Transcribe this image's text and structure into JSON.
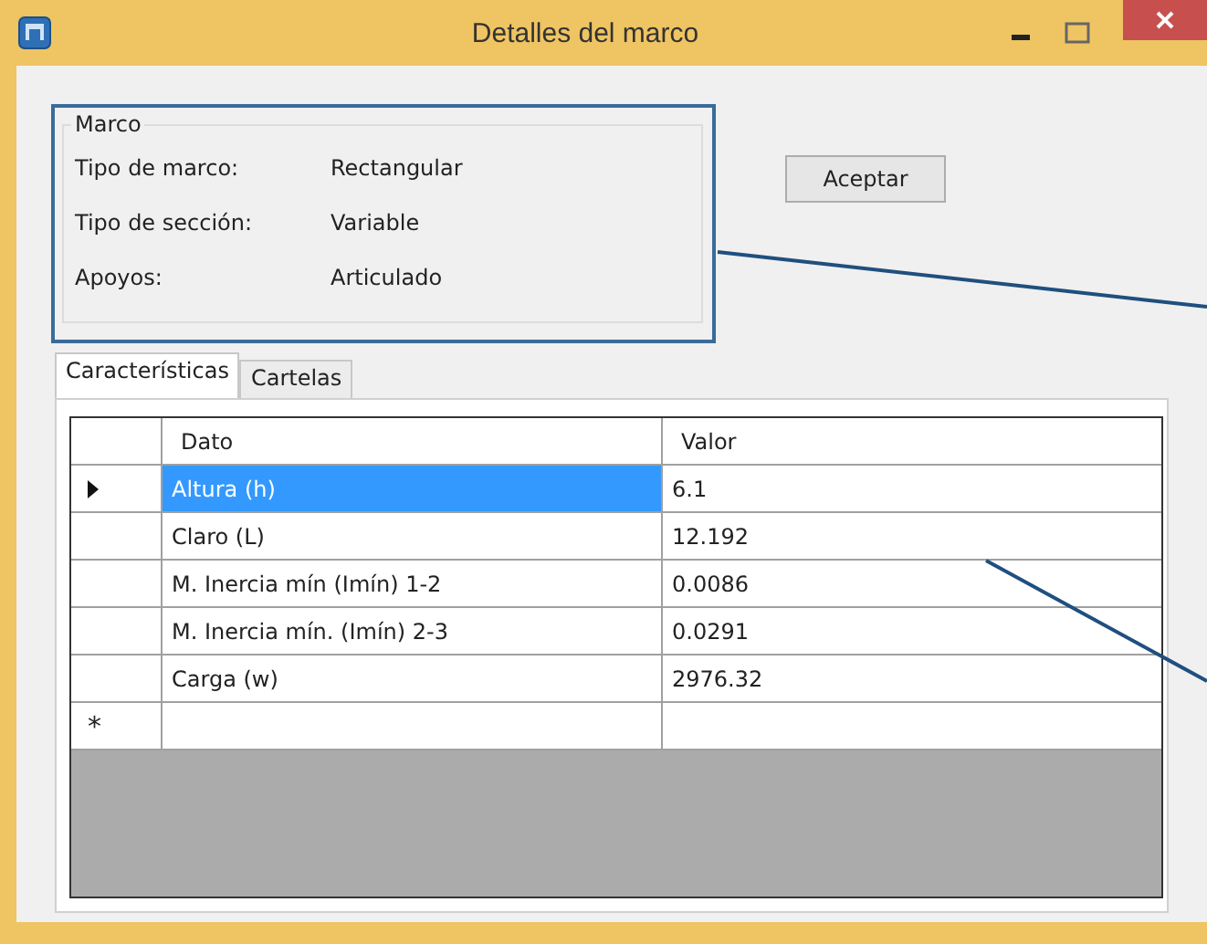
{
  "window": {
    "title": "Detalles del marco"
  },
  "frame_group": {
    "title": "Marco",
    "fields": [
      {
        "label": "Tipo de marco:",
        "value": "Rectangular"
      },
      {
        "label": "Tipo de sección:",
        "value": "Variable"
      },
      {
        "label": "Apoyos:",
        "value": "Articulado"
      }
    ]
  },
  "buttons": [
    "Aceptar"
  ],
  "tabs": [
    {
      "label": "Características",
      "selected": true
    },
    {
      "label": "Cartelas",
      "selected": false
    }
  ],
  "table": {
    "columns": [
      "Dato",
      "Valor"
    ],
    "rows": [
      {
        "dato": "Altura (h)",
        "valor": "6.1",
        "selected": true
      },
      {
        "dato": "Claro (L)",
        "valor": "12.192",
        "selected": false
      },
      {
        "dato": "M. Inercia mín (Imín) 1-2",
        "valor": "0.0086",
        "selected": false
      },
      {
        "dato": "M. Inercia mín. (Imín) 2-3",
        "valor": "0.0291",
        "selected": false
      },
      {
        "dato": "Carga (w)",
        "valor": "2976.32",
        "selected": false
      }
    ],
    "new_row_marker": "*"
  }
}
